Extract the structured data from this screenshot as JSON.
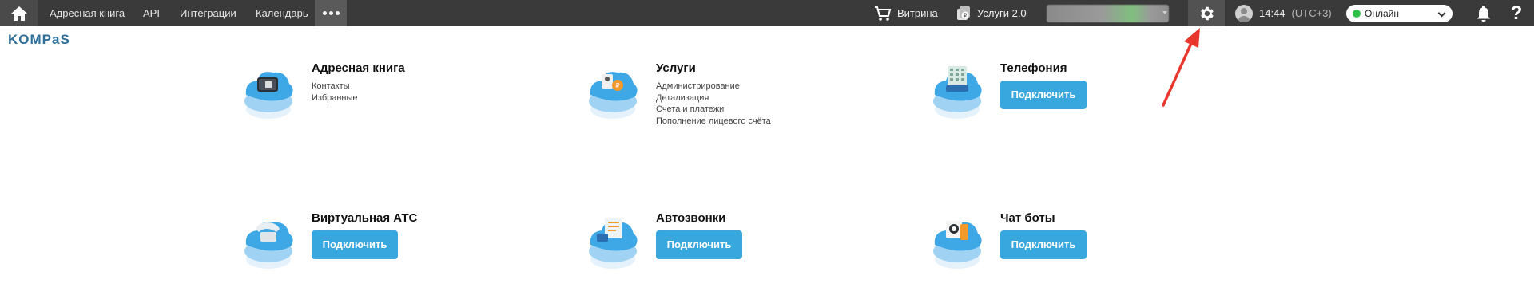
{
  "topbar": {
    "nav": [
      "Адресная книга",
      "API",
      "Интеграции",
      "Календарь"
    ],
    "showcase_label": "Витрина",
    "services2_label": "Услуги 2.0",
    "time": "14:44",
    "timezone": "(UTC+3)",
    "status_value": "Онлайн",
    "help_label": "?"
  },
  "logo": "KOMPaS",
  "colors": {
    "accent": "#37a7de",
    "topbar": "#3a3a3a",
    "status_online": "#2fbf4a",
    "arrow": "#e8372c"
  },
  "icons": [
    "home-icon",
    "more-icon",
    "cart-icon",
    "services-icon",
    "gear-icon",
    "avatar",
    "bell-icon",
    "help-icon"
  ],
  "tiles": [
    {
      "title": "Адресная книга",
      "links": [
        "Контакты",
        "Избранные"
      ]
    },
    {
      "title": "Услуги",
      "links": [
        "Администрирование",
        "Детализация",
        "Счета и платежи",
        "Пополнение лицевого счёта"
      ]
    },
    {
      "title": "Телефония",
      "button": "Подключить"
    },
    {
      "title": "Виртуальная АТС",
      "button": "Подключить"
    },
    {
      "title": "Автозвонки",
      "button": "Подключить"
    },
    {
      "title": "Чат боты",
      "button": "Подключить"
    }
  ]
}
